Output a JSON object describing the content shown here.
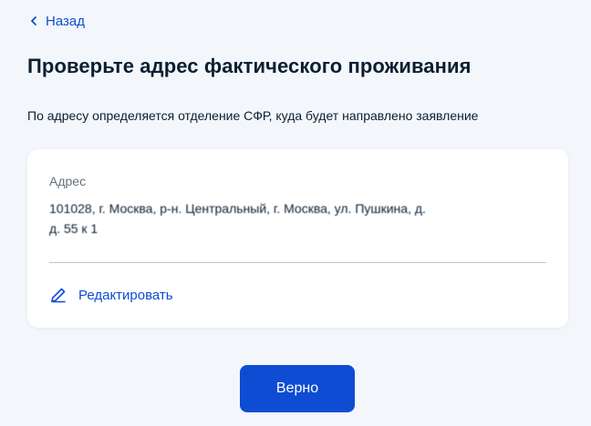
{
  "nav": {
    "back_label": "Назад"
  },
  "header": {
    "title": "Проверьте адрес фактического проживания",
    "subtitle": "По адресу определяется отделение СФР, куда будет направлено заявление"
  },
  "address_card": {
    "label": "Адрес",
    "value_line1": "101028, г. Москва, р-н. Центральный, г. Москва, ул. Пушкина, д.",
    "value_line2": "д. 55 к 1",
    "edit_label": "Редактировать"
  },
  "actions": {
    "confirm_label": "Верно"
  },
  "colors": {
    "accent": "#0d4cd3",
    "background": "#f3f6fa",
    "card": "#ffffff",
    "text": "#0b1f33",
    "muted": "#66727f",
    "divider": "#b6c8d8"
  },
  "icons": {
    "back": "chevron-left-icon",
    "edit": "pencil-icon"
  }
}
